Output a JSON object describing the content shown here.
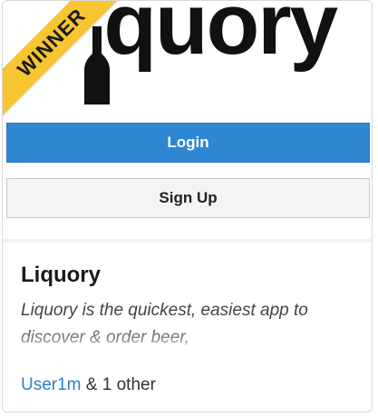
{
  "badge": {
    "label": "WINNER",
    "color": "#f7c531"
  },
  "logo": {
    "text_before": "Li",
    "text_after": "quory",
    "icon": "bottle-icon"
  },
  "buttons": {
    "login_label": "Login",
    "signup_label": "Sign Up",
    "login_color": "#2f86d3"
  },
  "product": {
    "name": "Liquory",
    "description": "Liquory is the quickest, easiest app to discover & order beer,"
  },
  "voters": {
    "user_link": "User1m",
    "suffix": " & 1 other"
  }
}
